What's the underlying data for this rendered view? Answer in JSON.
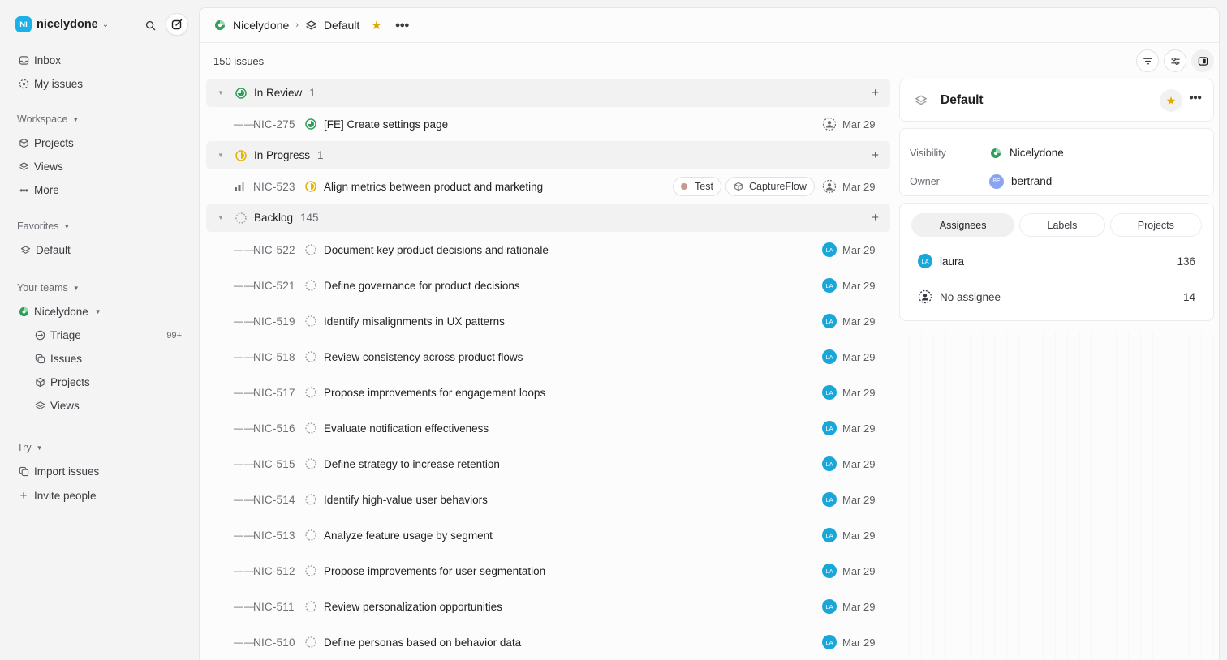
{
  "workspace": {
    "initials": "NI",
    "name": "nicelydone"
  },
  "sidebar": {
    "top_items": [
      {
        "label": "Inbox",
        "icon": "inbox-icon"
      },
      {
        "label": "My issues",
        "icon": "my-issues-icon"
      }
    ],
    "workspace_section": {
      "header": "Workspace",
      "items": [
        {
          "label": "Projects",
          "icon": "cube-icon"
        },
        {
          "label": "Views",
          "icon": "layers-icon"
        },
        {
          "label": "More",
          "icon": "more-icon"
        }
      ]
    },
    "favorites_section": {
      "header": "Favorites",
      "items": [
        {
          "label": "Default",
          "icon": "layers-icon"
        }
      ]
    },
    "teams_section": {
      "header": "Your teams",
      "team": {
        "label": "Nicelydone"
      },
      "items": [
        {
          "label": "Triage",
          "badge": "99+",
          "icon": "triage-icon"
        },
        {
          "label": "Issues",
          "icon": "issues-icon"
        },
        {
          "label": "Projects",
          "icon": "cube-icon"
        },
        {
          "label": "Views",
          "icon": "layers-icon"
        }
      ]
    },
    "try_section": {
      "header": "Try",
      "items": [
        {
          "label": "Import issues",
          "icon": "import-icon"
        },
        {
          "label": "Invite people",
          "icon": "plus-icon"
        }
      ]
    }
  },
  "breadcrumb": {
    "team": "Nicelydone",
    "view": "Default"
  },
  "issue_count": "150 issues",
  "groups": {
    "in_review": {
      "name": "In Review",
      "count": "1"
    },
    "in_progress": {
      "name": "In Progress",
      "count": "1"
    },
    "backlog": {
      "name": "Backlog",
      "count": "145"
    }
  },
  "issues": {
    "review": {
      "id": "NIC-275",
      "title": "[FE] Create settings page",
      "date": "Mar 29"
    },
    "progress": {
      "id": "NIC-523",
      "title": "Align metrics between product and marketing",
      "label": "Test",
      "project": "CaptureFlow",
      "date": "Mar 29"
    },
    "backlog": [
      {
        "id": "NIC-522",
        "title": "Document key product decisions and rationale",
        "assignee": "LA",
        "date": "Mar 29"
      },
      {
        "id": "NIC-521",
        "title": "Define governance for product decisions",
        "assignee": "LA",
        "date": "Mar 29"
      },
      {
        "id": "NIC-519",
        "title": "Identify misalignments in UX patterns",
        "assignee": "LA",
        "date": "Mar 29"
      },
      {
        "id": "NIC-518",
        "title": "Review consistency across product flows",
        "assignee": "LA",
        "date": "Mar 29"
      },
      {
        "id": "NIC-517",
        "title": "Propose improvements for engagement loops",
        "assignee": "LA",
        "date": "Mar 29"
      },
      {
        "id": "NIC-516",
        "title": "Evaluate notification effectiveness",
        "assignee": "LA",
        "date": "Mar 29"
      },
      {
        "id": "NIC-515",
        "title": "Define strategy to increase retention",
        "assignee": "LA",
        "date": "Mar 29"
      },
      {
        "id": "NIC-514",
        "title": "Identify high-value user behaviors",
        "assignee": "LA",
        "date": "Mar 29"
      },
      {
        "id": "NIC-513",
        "title": "Analyze feature usage by segment",
        "assignee": "LA",
        "date": "Mar 29"
      },
      {
        "id": "NIC-512",
        "title": "Propose improvements for user segmentation",
        "assignee": "LA",
        "date": "Mar 29"
      },
      {
        "id": "NIC-511",
        "title": "Review personalization opportunities",
        "assignee": "LA",
        "date": "Mar 29"
      },
      {
        "id": "NIC-510",
        "title": "Define personas based on behavior data",
        "assignee": "LA",
        "date": "Mar 29"
      }
    ]
  },
  "panel": {
    "title": "Default",
    "visibility_label": "Visibility",
    "visibility_value": "Nicelydone",
    "owner_label": "Owner",
    "owner_initials": "BE",
    "owner_value": "bertrand",
    "tabs": [
      "Assignees",
      "Labels",
      "Projects"
    ],
    "stats": [
      {
        "initials": "LA",
        "label": "laura",
        "count": "136"
      },
      {
        "label": "No assignee",
        "count": "14"
      }
    ]
  },
  "colors": {
    "accent": "#19a6d8",
    "review_green": "#2f9e5b",
    "progress_yellow": "#e5b300",
    "star": "#e0a800"
  }
}
